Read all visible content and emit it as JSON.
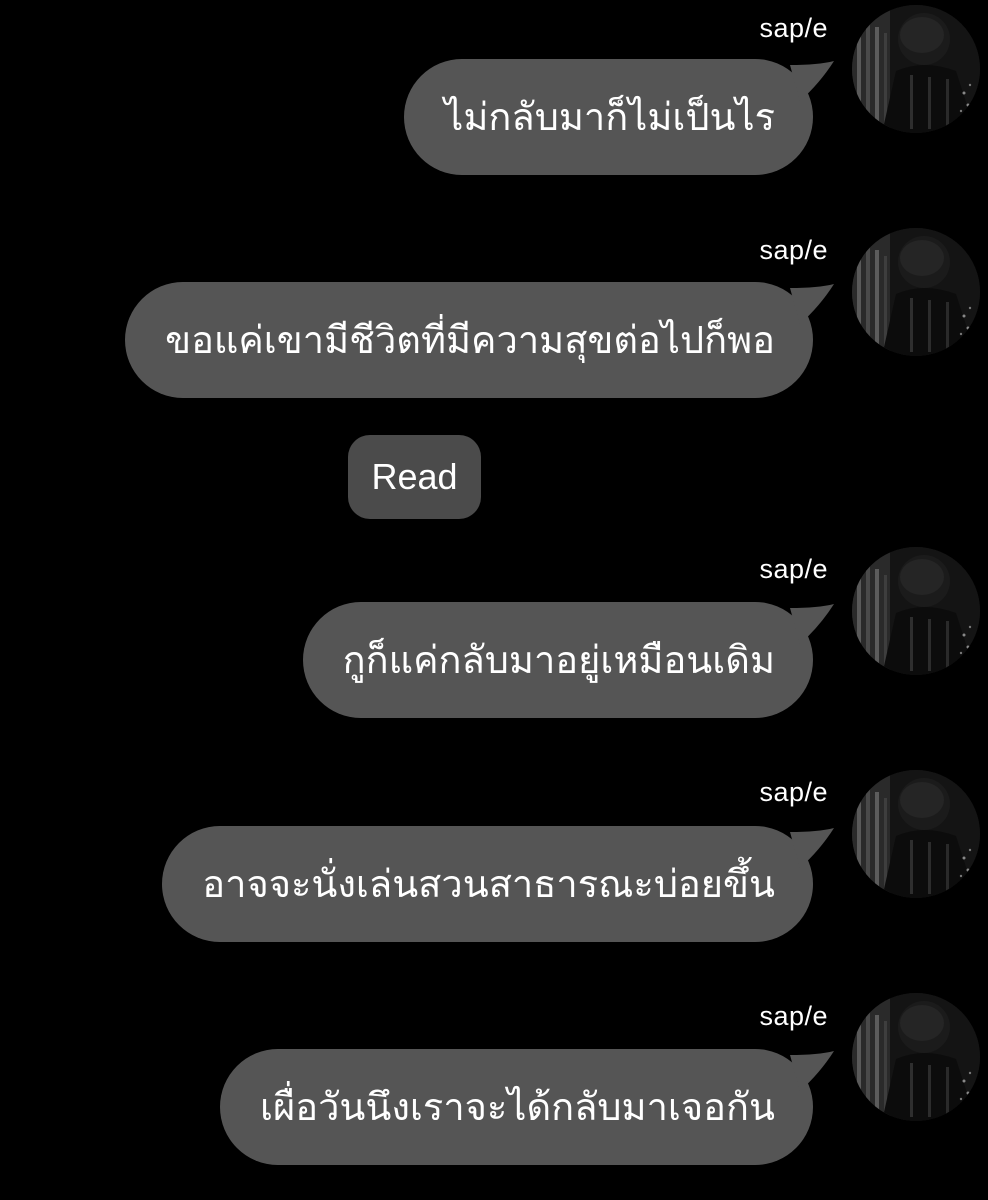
{
  "messages": [
    {
      "sender": "sap/e",
      "text": "ไม่กลับมาก็ไม่เป็นไร"
    },
    {
      "sender": "sap/e",
      "text": "ขอแค่เขามีชีวิตที่มีความสุขต่อไปก็พอ"
    },
    {
      "sender": "sap/e",
      "text": "กูก็แค่กลับมาอยู่เหมือนเดิม"
    },
    {
      "sender": "sap/e",
      "text": "อาจจะนั่งเล่นสวนสาธารณะบ่อยขึ้น"
    },
    {
      "sender": "sap/e",
      "text": "เผื่อวันนึงเราจะได้กลับมาเจอกัน"
    }
  ],
  "read_receipt": "Read",
  "colors": {
    "background": "#000000",
    "bubble": "#555555",
    "read_chip": "#4b4b4b",
    "text": "#ffffff"
  },
  "avatar_icon": "profile-photo-icon"
}
